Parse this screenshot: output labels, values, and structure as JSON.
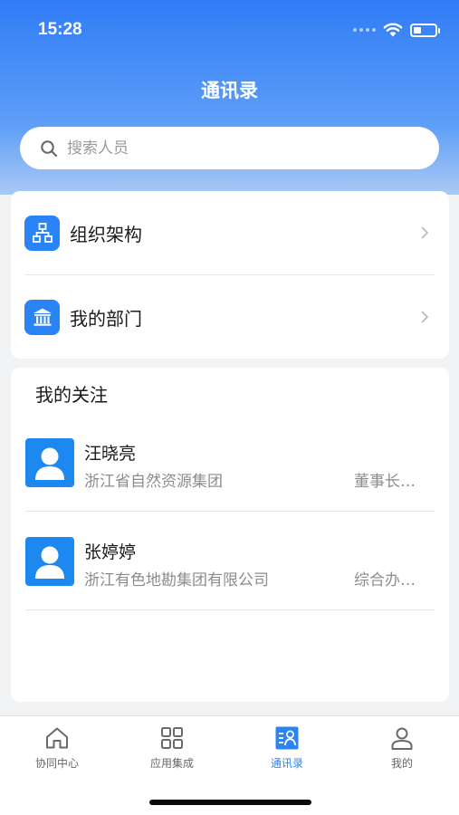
{
  "status_bar": {
    "time": "15:28",
    "icons": [
      "signal-dots-icon",
      "wifi-icon",
      "battery-icon"
    ],
    "battery_level": 0.35
  },
  "header": {
    "title": "通讯录"
  },
  "search": {
    "placeholder": "搜索人员",
    "icon": "search-icon"
  },
  "nav": {
    "items": [
      {
        "label": "组织架构",
        "icon": "org-chart-icon"
      },
      {
        "label": "我的部门",
        "icon": "building-icon"
      }
    ]
  },
  "follow": {
    "title": "我的关注",
    "contacts": [
      {
        "name": "汪晓亮",
        "org": "浙江省自然资源集团",
        "role": "董事长…"
      },
      {
        "name": "张婷婷",
        "org": "浙江有色地勘集团有限公司",
        "role": "综合办…"
      }
    ]
  },
  "tabbar": {
    "tabs": [
      {
        "label": "协同中心",
        "icon": "home-icon",
        "active": false
      },
      {
        "label": "应用集成",
        "icon": "grid-icon",
        "active": false
      },
      {
        "label": "通讯录",
        "icon": "contacts-icon",
        "active": true
      },
      {
        "label": "我的",
        "icon": "user-icon",
        "active": false
      }
    ]
  },
  "colors": {
    "accent": "#2b84f5",
    "header_top": "#2f7cf6",
    "background": "#f2f3f5"
  }
}
